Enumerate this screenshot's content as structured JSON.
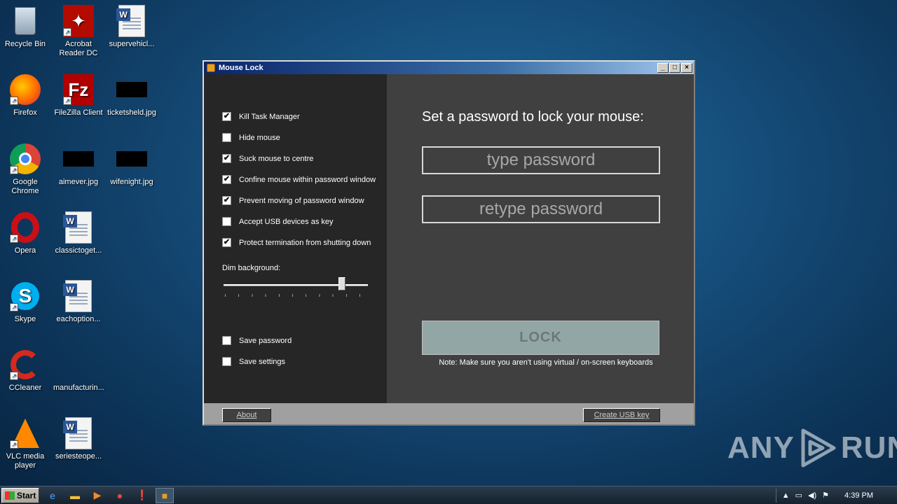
{
  "desktop": {
    "icons": [
      {
        "label": "Recycle Bin",
        "icon": "recycle-bin-icon"
      },
      {
        "label": "Acrobat Reader DC",
        "icon": "acrobat-icon"
      },
      {
        "label": "supervehicl...",
        "icon": "word-doc-icon"
      },
      {
        "label": "Firefox",
        "icon": "firefox-icon"
      },
      {
        "label": "FileZilla Client",
        "icon": "filezilla-icon"
      },
      {
        "label": "ticketsheld.jpg",
        "icon": "image-icon"
      },
      {
        "label": "Google Chrome",
        "icon": "chrome-icon"
      },
      {
        "label": "aimever.jpg",
        "icon": "image-icon"
      },
      {
        "label": "wifenight.jpg",
        "icon": "image-icon"
      },
      {
        "label": "Opera",
        "icon": "opera-icon"
      },
      {
        "label": "classictoget...",
        "icon": "word-doc-icon"
      },
      {
        "label": "Skype",
        "icon": "skype-icon"
      },
      {
        "label": "eachoption...",
        "icon": "word-doc-icon"
      },
      {
        "label": "CCleaner",
        "icon": "ccleaner-icon"
      },
      {
        "label": "manufacturin...",
        "icon": "blank-doc-icon"
      },
      {
        "label": "VLC media player",
        "icon": "vlc-icon"
      },
      {
        "label": "seriesteope...",
        "icon": "word-doc-icon"
      }
    ]
  },
  "window": {
    "title": "Mouse Lock",
    "minimize": "_",
    "maximize": "□",
    "close": "×",
    "options": [
      {
        "label": "Kill Task Manager",
        "checked": true
      },
      {
        "label": "Hide mouse",
        "checked": false
      },
      {
        "label": "Suck mouse to centre",
        "checked": true
      },
      {
        "label": "Confine mouse within password window",
        "checked": true
      },
      {
        "label": "Prevent moving of password window",
        "checked": true
      },
      {
        "label": "Accept USB devices as key",
        "checked": false
      },
      {
        "label": "Protect termination from shutting down",
        "checked": true
      }
    ],
    "dim_label": "Dim background:",
    "dim_value": 0.82,
    "save_options": [
      {
        "label": "Save password",
        "checked": false
      },
      {
        "label": "Save settings",
        "checked": false
      }
    ],
    "prompt": "Set a password to lock your mouse:",
    "password_placeholder": "type password",
    "retype_placeholder": "retype password",
    "lock_label": "LOCK",
    "note": "Note: Make sure you aren't using virtual / on-screen keyboards",
    "about_label": "About",
    "usb_label": "Create USB key"
  },
  "watermark": {
    "left": "ANY",
    "right": "RUN"
  },
  "taskbar": {
    "start_label": "Start",
    "clock": "4:39 PM"
  }
}
